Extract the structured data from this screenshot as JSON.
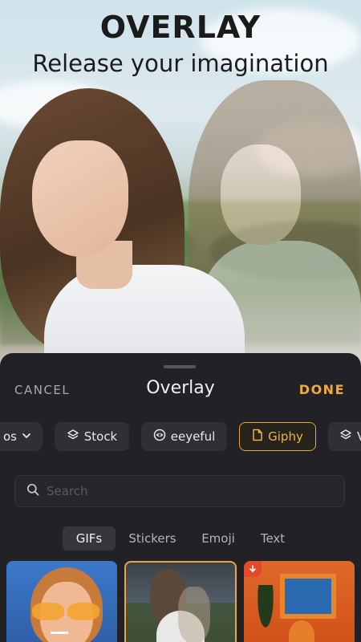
{
  "promo": {
    "title": "OVERLAY",
    "subtitle": "Release your imagination"
  },
  "header": {
    "cancel_label": "CANCEL",
    "title": "Overlay",
    "done_label": "DONE"
  },
  "sources": [
    {
      "label": "os",
      "icon": "chevron-down-icon",
      "active": false
    },
    {
      "label": "Stock",
      "icon": "layers-icon",
      "active": false
    },
    {
      "label": "eeyeful",
      "icon": "eye-icon",
      "active": false
    },
    {
      "label": "Giphy",
      "icon": "file-icon",
      "active": true
    },
    {
      "label": "V",
      "icon": "layers-icon",
      "active": false
    }
  ],
  "search": {
    "placeholder": "Search",
    "value": ""
  },
  "tabs": [
    {
      "label": "GIFs",
      "active": true
    },
    {
      "label": "Stickers",
      "active": false
    },
    {
      "label": "Emoji",
      "active": false
    },
    {
      "label": "Text",
      "active": false
    }
  ],
  "colors": {
    "accent": "#f2a93b",
    "sheet_bg": "#222226",
    "chip_bg": "#2f3034"
  }
}
